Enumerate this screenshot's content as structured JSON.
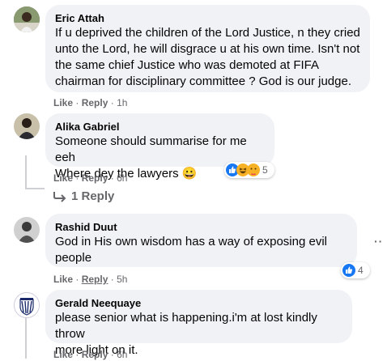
{
  "comments": [
    {
      "author": "Eric Attah",
      "text": "If u deprived the children of the Lord Justice, n they cried\nunto the Lord, he will disgrace u at his own time. Isn't not\nthe same chief Justice who was demoted at FIFA\nchairman for disciplinary committee ? God is our judge.",
      "like": "Like",
      "reply": "Reply",
      "time": "1h"
    },
    {
      "author": "Alika Gabriel",
      "text": "Someone should summarise for me eeh\nWhere dey the lawyers 😀",
      "like": "Like",
      "reply": "Reply",
      "time": "6h",
      "reaction_count": "5",
      "reply_count_label": "1 Reply"
    },
    {
      "author": "Rashid Duut",
      "text": "God in His own wisdom has a way of exposing evil\npeople",
      "like": "Like",
      "reply": "Reply",
      "time": "5h",
      "reaction_count": "4"
    },
    {
      "author": "Gerald Neequaye",
      "text": "please senior what is happening.i'm at lost kindly throw\nmore light on it.",
      "like": "Like",
      "reply": "Reply",
      "time": "6h"
    }
  ],
  "separator": "·",
  "colors": {
    "like_blue": "#1877f2",
    "haha_yellow": "#f7b125",
    "bubble": "#f0f2f5",
    "meta": "#65676b"
  }
}
